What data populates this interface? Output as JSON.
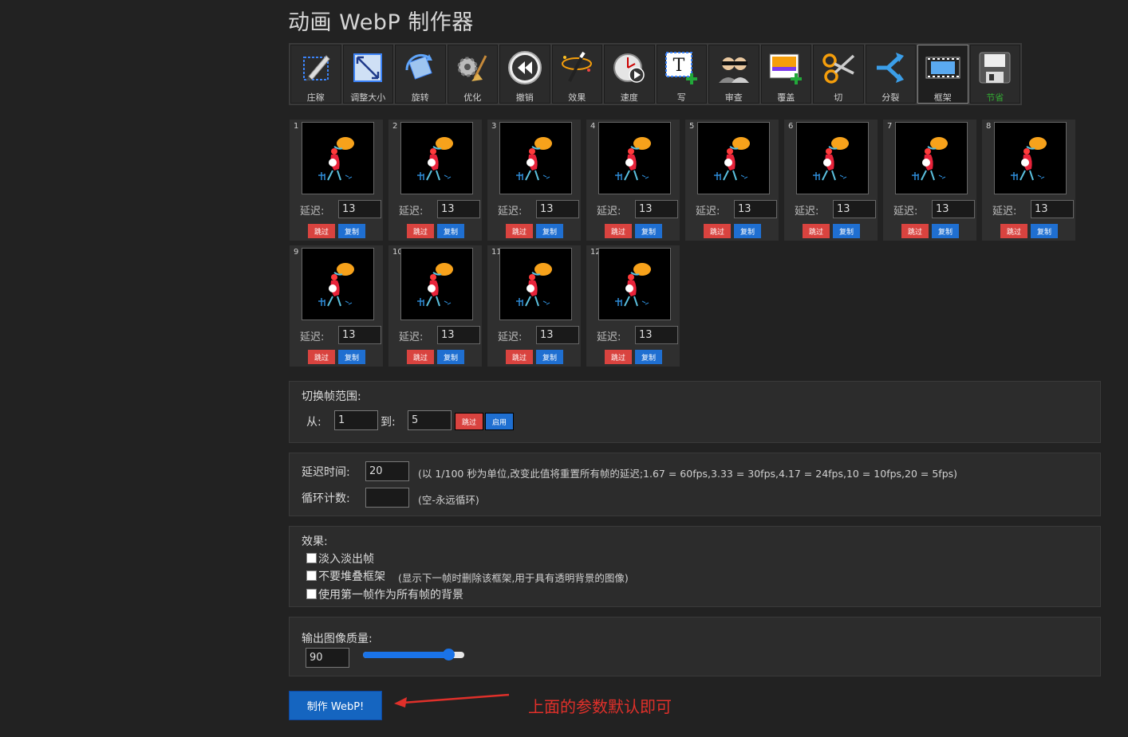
{
  "title": "动画 WebP 制作器",
  "toolbar": [
    {
      "label": "庄稼",
      "icon": "crop-icon"
    },
    {
      "label": "调整大小",
      "icon": "resize-icon"
    },
    {
      "label": "旋转",
      "icon": "rotate-icon"
    },
    {
      "label": "优化",
      "icon": "optimize-icon"
    },
    {
      "label": "撤销",
      "icon": "reverse-icon"
    },
    {
      "label": "效果",
      "icon": "effects-icon"
    },
    {
      "label": "速度",
      "icon": "speed-icon"
    },
    {
      "label": "写",
      "icon": "text-icon"
    },
    {
      "label": "审查",
      "icon": "censor-icon"
    },
    {
      "label": "覆盖",
      "icon": "overlay-icon"
    },
    {
      "label": "切",
      "icon": "cut-icon"
    },
    {
      "label": "分裂",
      "icon": "split-icon"
    },
    {
      "label": "框架",
      "icon": "frames-icon"
    },
    {
      "label": "节省",
      "icon": "save-icon"
    }
  ],
  "frames": {
    "delay_label": "延迟:",
    "skip_label": "跳过",
    "copy_label": "复制",
    "items": [
      {
        "num": "1",
        "delay": "13"
      },
      {
        "num": "2",
        "delay": "13"
      },
      {
        "num": "3",
        "delay": "13"
      },
      {
        "num": "4",
        "delay": "13"
      },
      {
        "num": "5",
        "delay": "13"
      },
      {
        "num": "6",
        "delay": "13"
      },
      {
        "num": "7",
        "delay": "13"
      },
      {
        "num": "8",
        "delay": "13"
      },
      {
        "num": "9",
        "delay": "13"
      },
      {
        "num": "10",
        "delay": "13"
      },
      {
        "num": "11",
        "delay": "13"
      },
      {
        "num": "12",
        "delay": "13"
      }
    ]
  },
  "toggle_range": {
    "title": "切换帧范围:",
    "from_label": "从:",
    "from_value": "1",
    "to_label": "到:",
    "to_value": "5",
    "skip_label": "跳过",
    "enable_label": "启用"
  },
  "timing": {
    "delay_label": "延迟时间:",
    "delay_value": "20",
    "delay_note": "(以 1/100 秒为单位,改变此值将重置所有帧的延迟;1.67 = 60fps,3.33 = 30fps,4.17 = 24fps,10 = 10fps,20 = 5fps)",
    "loop_label": "循环计数:",
    "loop_value": "",
    "loop_note": "(空-永远循环)"
  },
  "effects": {
    "title": "效果:",
    "options": [
      {
        "label": "淡入淡出帧",
        "checked": false
      },
      {
        "label": "不要堆叠框架",
        "note": "(显示下一帧时删除该框架,用于具有透明背景的图像)",
        "checked": false
      },
      {
        "label": "使用第一帧作为所有帧的背景",
        "checked": false
      }
    ]
  },
  "quality": {
    "label": "输出图像质量:",
    "value": "90",
    "slider_fraction": 0.85
  },
  "make_button": "制作 WebP!",
  "annotation": "上面的参数默认即可",
  "colors": {
    "skip": "#d9433f",
    "copy": "#1f6fd1",
    "primary": "#1565c0",
    "annotation": "#e0302a"
  }
}
